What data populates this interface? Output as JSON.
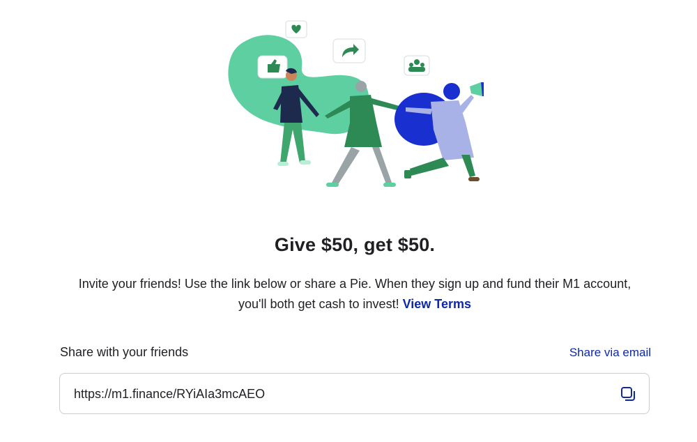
{
  "hero": {
    "illustration": "friends-holding-hands-illustration",
    "icons": [
      "thumbs-up-icon",
      "heart-icon",
      "share-arrow-icon",
      "group-icon",
      "megaphone-icon"
    ]
  },
  "headline": "Give $50, get $50.",
  "description": {
    "text": "Invite your friends! Use the link below or share a Pie. When they sign up and fund their M1 account, you'll both get cash to invest!",
    "terms_link": "View Terms"
  },
  "share": {
    "label": "Share with your friends",
    "email_link": "Share via email",
    "referral_url": "https://m1.finance/RYiAIa3mcAEO",
    "copy_icon": "copy-icon"
  },
  "colors": {
    "accent_link": "#0f28a8",
    "text": "#1f1f24",
    "illustration_green": "#5ecfa1",
    "illustration_dark_green": "#2e8a55",
    "illustration_blue": "#1a2fd0",
    "illustration_lavender": "#a9b2e6"
  }
}
